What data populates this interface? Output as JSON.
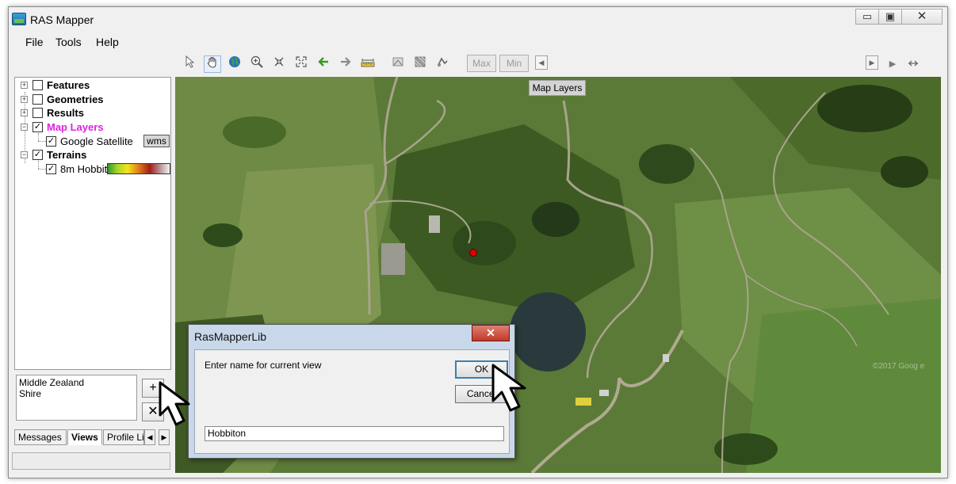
{
  "window": {
    "title": "RAS Mapper",
    "controls": {
      "minimize": "▭",
      "maximize": "▣",
      "close": "✕"
    }
  },
  "menu": {
    "items": [
      "File",
      "Tools",
      "Help"
    ]
  },
  "toolbar": {
    "tools": [
      "pointer-icon",
      "pan-hand-icon",
      "globe-icon",
      "zoom-in-icon",
      "zoom-extents-icon",
      "full-extent-icon",
      "back-arrow-icon",
      "forward-arrow-icon",
      "measure-icon",
      "layer-tool-icon",
      "raster-tool-icon",
      "profile-tool-icon"
    ],
    "max_label": "Max",
    "min_label": "Min"
  },
  "layers": {
    "items": [
      {
        "label": "Features",
        "checked": false,
        "expanded": false
      },
      {
        "label": "Geometries",
        "checked": false,
        "expanded": false
      },
      {
        "label": "Results",
        "checked": false,
        "expanded": false
      },
      {
        "label": "Map Layers",
        "checked": true,
        "expanded": true,
        "color": "#e020e0"
      },
      {
        "label": "Google Satellite",
        "checked": true,
        "badge": "wms"
      },
      {
        "label": "Terrains",
        "checked": true,
        "expanded": true
      },
      {
        "label": "8m Hobbit",
        "checked": true
      }
    ],
    "wms_badge": "wms"
  },
  "views": {
    "list": [
      "Middle Zealand",
      "Shire"
    ],
    "add_button": "+",
    "remove_button": "✕"
  },
  "tabs": {
    "items": [
      "Messages",
      "Views",
      "Profile Lir"
    ],
    "selected": "Views"
  },
  "map": {
    "layer_label": "Map Layers",
    "watermark": "©2017 Goog e"
  },
  "dialog": {
    "title": "RasMapperLib",
    "close": "✕",
    "prompt": "Enter name for current view",
    "ok": "OK",
    "cancel": "Cancel",
    "input_value": "Hobbiton"
  },
  "colors": {
    "accent_map_layers": "#e020e0",
    "dialog_frame": "#c8d8ea",
    "default_button_border": "#3c7fb1"
  }
}
